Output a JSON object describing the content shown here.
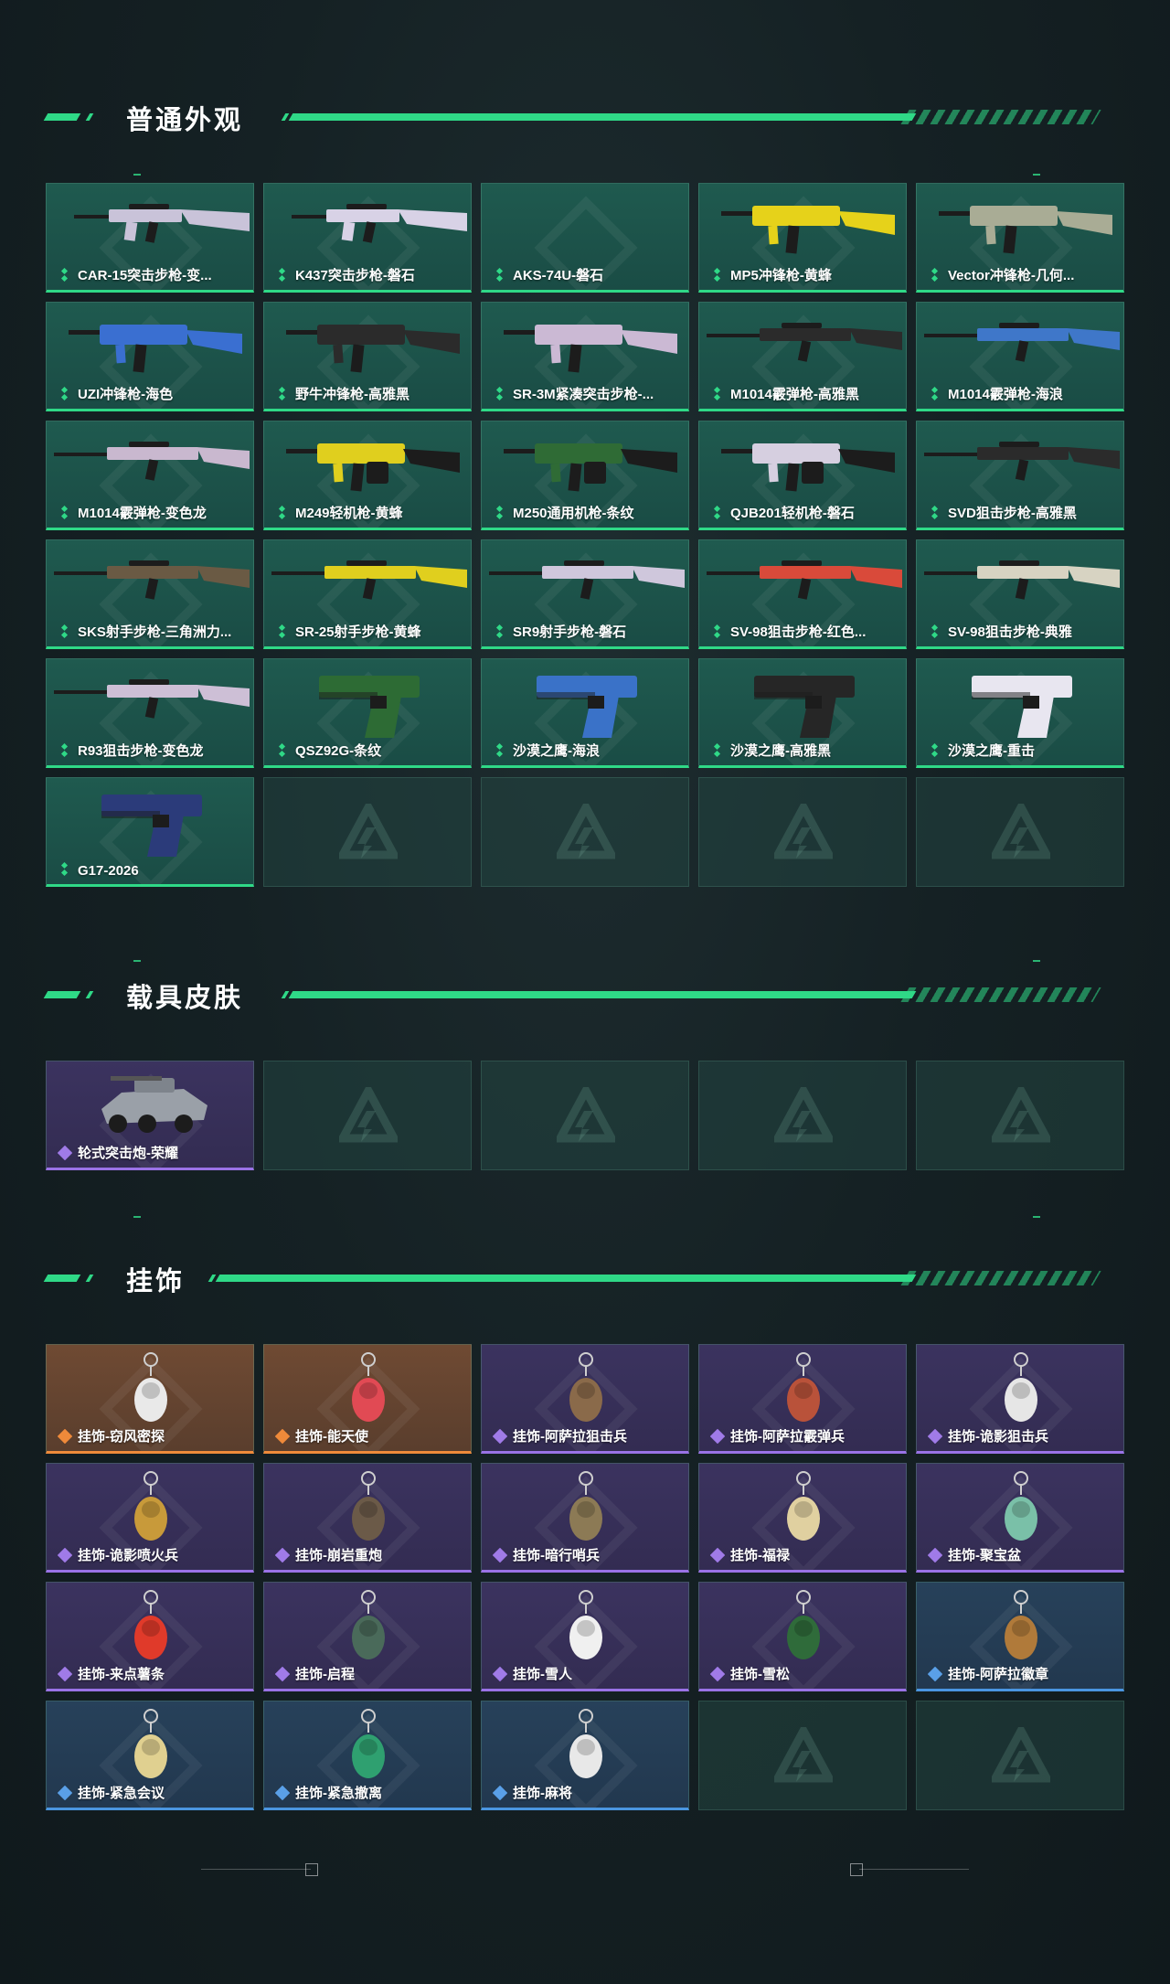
{
  "colors": {
    "accent": "#2fd987",
    "purple": "#9a72e6",
    "orange": "#ef8a3a",
    "blue": "#4a95e0"
  },
  "sections": [
    {
      "title": "普通外观",
      "items": [
        {
          "label": "CAR-15突击步枪-变...",
          "rarity": "green",
          "icon": "rifle-icon",
          "tint": "#c9c3d9"
        },
        {
          "label": "K437突击步枪-磐石",
          "rarity": "green",
          "icon": "rifle-icon",
          "tint": "#d8d2e6"
        },
        {
          "label": "AKS-74U-磐石",
          "rarity": "green",
          "icon": "",
          "tint": ""
        },
        {
          "label": "MP5冲锋枪-黄蜂",
          "rarity": "green",
          "icon": "smg-icon",
          "tint": "#e6d21a"
        },
        {
          "label": "Vector冲锋枪-几何...",
          "rarity": "green",
          "icon": "smg-icon",
          "tint": "#a9ac95"
        },
        {
          "label": "UZI冲锋枪-海色",
          "rarity": "green",
          "icon": "smg-icon",
          "tint": "#3a6fd1"
        },
        {
          "label": "野牛冲锋枪-高雅黑",
          "rarity": "green",
          "icon": "smg-icon",
          "tint": "#2b2b2b"
        },
        {
          "label": "SR-3M紧凑突击步枪-...",
          "rarity": "green",
          "icon": "smg-icon",
          "tint": "#cbb9d4"
        },
        {
          "label": "M1014霰弹枪-高雅黑",
          "rarity": "green",
          "icon": "shotgun-icon",
          "tint": "#2b2b2b"
        },
        {
          "label": "M1014霰弹枪-海浪",
          "rarity": "green",
          "icon": "shotgun-icon",
          "tint": "#3f77c9"
        },
        {
          "label": "M1014霰弹枪-变色龙",
          "rarity": "green",
          "icon": "shotgun-icon",
          "tint": "#c9b8cf"
        },
        {
          "label": "M249轻机枪-黄蜂",
          "rarity": "green",
          "icon": "lmg-icon",
          "tint": "#e0cf1e"
        },
        {
          "label": "M250通用机枪-条纹",
          "rarity": "green",
          "icon": "lmg-icon",
          "tint": "#2f6b35"
        },
        {
          "label": "QJB201轻机枪-磐石",
          "rarity": "green",
          "icon": "lmg-icon",
          "tint": "#d6cfe0"
        },
        {
          "label": "SVD狙击步枪-高雅黑",
          "rarity": "green",
          "icon": "sniper-icon",
          "tint": "#2b2b2b"
        },
        {
          "label": "SKS射手步枪-三角洲力...",
          "rarity": "green",
          "icon": "sniper-icon",
          "tint": "#6a5a44"
        },
        {
          "label": "SR-25射手步枪-黄蜂",
          "rarity": "green",
          "icon": "sniper-icon",
          "tint": "#e0cf1e"
        },
        {
          "label": "SR9射手步枪-磐石",
          "rarity": "green",
          "icon": "sniper-icon",
          "tint": "#cfc7dc"
        },
        {
          "label": "SV-98狙击步枪-红色...",
          "rarity": "green",
          "icon": "sniper-icon",
          "tint": "#d94a3a"
        },
        {
          "label": "SV-98狙击步枪-典雅",
          "rarity": "green",
          "icon": "sniper-icon",
          "tint": "#d7d3c2"
        },
        {
          "label": "R93狙击步枪-变色龙",
          "rarity": "green",
          "icon": "sniper-icon",
          "tint": "#cdbfd6"
        },
        {
          "label": "QSZ92G-条纹",
          "rarity": "green",
          "icon": "pistol-icon",
          "tint": "#2d6b34"
        },
        {
          "label": "沙漠之鹰-海浪",
          "rarity": "green",
          "icon": "pistol-icon",
          "tint": "#3a72c8"
        },
        {
          "label": "沙漠之鹰-高雅黑",
          "rarity": "green",
          "icon": "pistol-icon",
          "tint": "#262626"
        },
        {
          "label": "沙漠之鹰-重击",
          "rarity": "green",
          "icon": "pistol-icon",
          "tint": "#e8e6f0"
        },
        {
          "label": "G17-2026",
          "rarity": "green",
          "icon": "pistol-icon",
          "tint": "#2b3b7a"
        },
        {
          "label": "",
          "rarity": "empty"
        },
        {
          "label": "",
          "rarity": "empty"
        },
        {
          "label": "",
          "rarity": "empty"
        },
        {
          "label": "",
          "rarity": "empty"
        }
      ]
    },
    {
      "title": "载具皮肤",
      "items": [
        {
          "label": "轮式突击炮-荣耀",
          "rarity": "purple",
          "icon": "vehicle-icon",
          "tint": "#9aa0a8"
        },
        {
          "label": "",
          "rarity": "empty"
        },
        {
          "label": "",
          "rarity": "empty"
        },
        {
          "label": "",
          "rarity": "empty"
        },
        {
          "label": "",
          "rarity": "empty"
        }
      ]
    },
    {
      "title": "挂饰",
      "items": [
        {
          "label": "挂饰-窃风密探",
          "rarity": "orange",
          "icon": "charm-icon",
          "tint": "#e9e9e9"
        },
        {
          "label": "挂饰-能天使",
          "rarity": "orange",
          "icon": "charm-icon",
          "tint": "#e14a54"
        },
        {
          "label": "挂饰-阿萨拉狙击兵",
          "rarity": "purple",
          "icon": "charm-icon",
          "tint": "#8a6a4a"
        },
        {
          "label": "挂饰-阿萨拉霰弹兵",
          "rarity": "purple",
          "icon": "charm-icon",
          "tint": "#b9523a"
        },
        {
          "label": "挂饰-诡影狙击兵",
          "rarity": "purple",
          "icon": "charm-icon",
          "tint": "#e6e6e6"
        },
        {
          "label": "挂饰-诡影喷火兵",
          "rarity": "purple",
          "icon": "charm-icon",
          "tint": "#c89a3a"
        },
        {
          "label": "挂饰-崩岩重炮",
          "rarity": "purple",
          "icon": "charm-icon",
          "tint": "#6b5a48"
        },
        {
          "label": "挂饰-暗行哨兵",
          "rarity": "purple",
          "icon": "charm-icon",
          "tint": "#8c7a55"
        },
        {
          "label": "挂饰-福禄",
          "rarity": "purple",
          "icon": "charm-icon",
          "tint": "#e0d0a0"
        },
        {
          "label": "挂饰-聚宝盆",
          "rarity": "purple",
          "icon": "charm-icon",
          "tint": "#7ac0a8"
        },
        {
          "label": "挂饰-来点薯条",
          "rarity": "purple",
          "icon": "charm-icon",
          "tint": "#e03a2a"
        },
        {
          "label": "挂饰-启程",
          "rarity": "purple",
          "icon": "charm-icon",
          "tint": "#4a6a5a"
        },
        {
          "label": "挂饰-雪人",
          "rarity": "purple",
          "icon": "charm-icon",
          "tint": "#f0f0f0"
        },
        {
          "label": "挂饰-雪松",
          "rarity": "purple",
          "icon": "charm-icon",
          "tint": "#2f6b3a"
        },
        {
          "label": "挂饰-阿萨拉徽章",
          "rarity": "blue",
          "icon": "charm-icon",
          "tint": "#b07a3a"
        },
        {
          "label": "挂饰-紧急会议",
          "rarity": "blue",
          "icon": "charm-icon",
          "tint": "#e0d090"
        },
        {
          "label": "挂饰-紧急撤离",
          "rarity": "blue",
          "icon": "charm-icon",
          "tint": "#2fa070"
        },
        {
          "label": "挂饰-麻将",
          "rarity": "blue",
          "icon": "charm-icon",
          "tint": "#e8e8e8"
        },
        {
          "label": "",
          "rarity": "empty"
        },
        {
          "label": "",
          "rarity": "empty"
        }
      ]
    }
  ]
}
